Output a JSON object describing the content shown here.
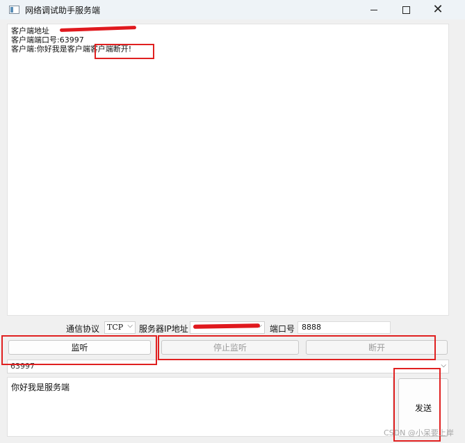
{
  "window": {
    "title": "网络调试助手服务端",
    "minimize_glyph": "",
    "close_glyph": "✕"
  },
  "receive_log": {
    "lines": [
      "客户端地址",
      "客户端端口号:63997",
      "客户端:你好我是客户端客户端断开!"
    ]
  },
  "config": {
    "protocol_label": "通信协议",
    "protocol_value": "TCP",
    "ip_label": "服务器IP地址",
    "port_label": "端口号",
    "port_value": "8888"
  },
  "buttons": {
    "listen": "监听",
    "stop_listen": "停止监听",
    "disconnect": "断开",
    "send": "发送"
  },
  "client_select": {
    "value": "63997"
  },
  "send_box": {
    "text": "你好我是服务端"
  },
  "annotation": {
    "color": "#e02020",
    "redaction_color": "#e0191e"
  },
  "watermark": "CSDN @小呆要上岸",
  "icons": {
    "dropdown": "chevron-down-icon",
    "app": "app-window-icon"
  }
}
